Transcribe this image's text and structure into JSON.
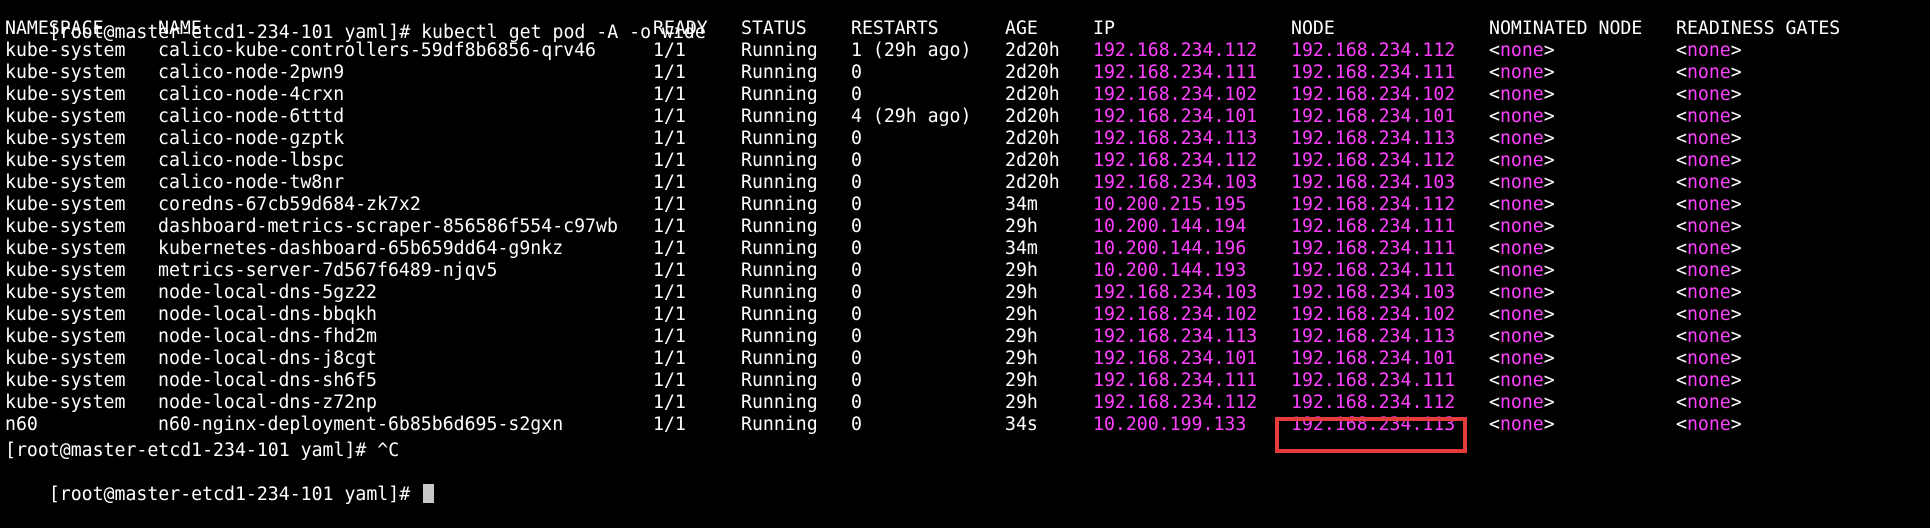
{
  "command_line": {
    "prompt": "[root@master-etcd1-234-101 yaml]# ",
    "command": "kubectl get pod -A -o wide"
  },
  "headers": {
    "namespace": "NAMESPACE",
    "name": "NAME",
    "ready": "READY",
    "status": "STATUS",
    "restarts": "RESTARTS",
    "age": "AGE",
    "ip": "IP",
    "node": "NODE",
    "nominated_node": "NOMINATED NODE",
    "readiness_gates": "READINESS GATES"
  },
  "rows": [
    {
      "namespace": "kube-system",
      "name": "calico-kube-controllers-59df8b6856-qrv46",
      "ready": "1/1",
      "status": "Running",
      "restarts": "1 (29h ago)",
      "age": "2d20h",
      "ip": "192.168.234.112",
      "node": "192.168.234.112",
      "nominated": "none",
      "readiness": "none"
    },
    {
      "namespace": "kube-system",
      "name": "calico-node-2pwn9",
      "ready": "1/1",
      "status": "Running",
      "restarts": "0",
      "age": "2d20h",
      "ip": "192.168.234.111",
      "node": "192.168.234.111",
      "nominated": "none",
      "readiness": "none"
    },
    {
      "namespace": "kube-system",
      "name": "calico-node-4crxn",
      "ready": "1/1",
      "status": "Running",
      "restarts": "0",
      "age": "2d20h",
      "ip": "192.168.234.102",
      "node": "192.168.234.102",
      "nominated": "none",
      "readiness": "none"
    },
    {
      "namespace": "kube-system",
      "name": "calico-node-6tttd",
      "ready": "1/1",
      "status": "Running",
      "restarts": "4 (29h ago)",
      "age": "2d20h",
      "ip": "192.168.234.101",
      "node": "192.168.234.101",
      "nominated": "none",
      "readiness": "none"
    },
    {
      "namespace": "kube-system",
      "name": "calico-node-gzptk",
      "ready": "1/1",
      "status": "Running",
      "restarts": "0",
      "age": "2d20h",
      "ip": "192.168.234.113",
      "node": "192.168.234.113",
      "nominated": "none",
      "readiness": "none"
    },
    {
      "namespace": "kube-system",
      "name": "calico-node-lbspc",
      "ready": "1/1",
      "status": "Running",
      "restarts": "0",
      "age": "2d20h",
      "ip": "192.168.234.112",
      "node": "192.168.234.112",
      "nominated": "none",
      "readiness": "none"
    },
    {
      "namespace": "kube-system",
      "name": "calico-node-tw8nr",
      "ready": "1/1",
      "status": "Running",
      "restarts": "0",
      "age": "2d20h",
      "ip": "192.168.234.103",
      "node": "192.168.234.103",
      "nominated": "none",
      "readiness": "none"
    },
    {
      "namespace": "kube-system",
      "name": "coredns-67cb59d684-zk7x2",
      "ready": "1/1",
      "status": "Running",
      "restarts": "0",
      "age": "34m",
      "ip": "10.200.215.195",
      "node": "192.168.234.112",
      "nominated": "none",
      "readiness": "none"
    },
    {
      "namespace": "kube-system",
      "name": "dashboard-metrics-scraper-856586f554-c97wb",
      "ready": "1/1",
      "status": "Running",
      "restarts": "0",
      "age": "29h",
      "ip": "10.200.144.194",
      "node": "192.168.234.111",
      "nominated": "none",
      "readiness": "none"
    },
    {
      "namespace": "kube-system",
      "name": "kubernetes-dashboard-65b659dd64-g9nkz",
      "ready": "1/1",
      "status": "Running",
      "restarts": "0",
      "age": "34m",
      "ip": "10.200.144.196",
      "node": "192.168.234.111",
      "nominated": "none",
      "readiness": "none"
    },
    {
      "namespace": "kube-system",
      "name": "metrics-server-7d567f6489-njqv5",
      "ready": "1/1",
      "status": "Running",
      "restarts": "0",
      "age": "29h",
      "ip": "10.200.144.193",
      "node": "192.168.234.111",
      "nominated": "none",
      "readiness": "none"
    },
    {
      "namespace": "kube-system",
      "name": "node-local-dns-5gz22",
      "ready": "1/1",
      "status": "Running",
      "restarts": "0",
      "age": "29h",
      "ip": "192.168.234.103",
      "node": "192.168.234.103",
      "nominated": "none",
      "readiness": "none"
    },
    {
      "namespace": "kube-system",
      "name": "node-local-dns-bbqkh",
      "ready": "1/1",
      "status": "Running",
      "restarts": "0",
      "age": "29h",
      "ip": "192.168.234.102",
      "node": "192.168.234.102",
      "nominated": "none",
      "readiness": "none"
    },
    {
      "namespace": "kube-system",
      "name": "node-local-dns-fhd2m",
      "ready": "1/1",
      "status": "Running",
      "restarts": "0",
      "age": "29h",
      "ip": "192.168.234.113",
      "node": "192.168.234.113",
      "nominated": "none",
      "readiness": "none"
    },
    {
      "namespace": "kube-system",
      "name": "node-local-dns-j8cgt",
      "ready": "1/1",
      "status": "Running",
      "restarts": "0",
      "age": "29h",
      "ip": "192.168.234.101",
      "node": "192.168.234.101",
      "nominated": "none",
      "readiness": "none"
    },
    {
      "namespace": "kube-system",
      "name": "node-local-dns-sh6f5",
      "ready": "1/1",
      "status": "Running",
      "restarts": "0",
      "age": "29h",
      "ip": "192.168.234.111",
      "node": "192.168.234.111",
      "nominated": "none",
      "readiness": "none"
    },
    {
      "namespace": "kube-system",
      "name": "node-local-dns-z72np",
      "ready": "1/1",
      "status": "Running",
      "restarts": "0",
      "age": "29h",
      "ip": "192.168.234.112",
      "node": "192.168.234.112",
      "nominated": "none",
      "readiness": "none"
    },
    {
      "namespace": "n60",
      "name": "n60-nginx-deployment-6b85b6d695-s2gxn",
      "ready": "1/1",
      "status": "Running",
      "restarts": "0",
      "age": "34s",
      "ip": "10.200.199.133",
      "node": "192.168.234.113",
      "nominated": "none",
      "readiness": "none"
    }
  ],
  "after_lines": [
    "[root@master-etcd1-234-101 yaml]# ^C",
    "[root@master-etcd1-234-101 yaml]# "
  ],
  "colors": {
    "background": "#000000",
    "text": "#ffffff",
    "ip_highlight": "#ff40ff",
    "annotation_box": "#e63b3b"
  },
  "highlight": {
    "row_name": "n60-nginx-deployment-6b85b6d695-s2gxn",
    "column": "NODE"
  }
}
